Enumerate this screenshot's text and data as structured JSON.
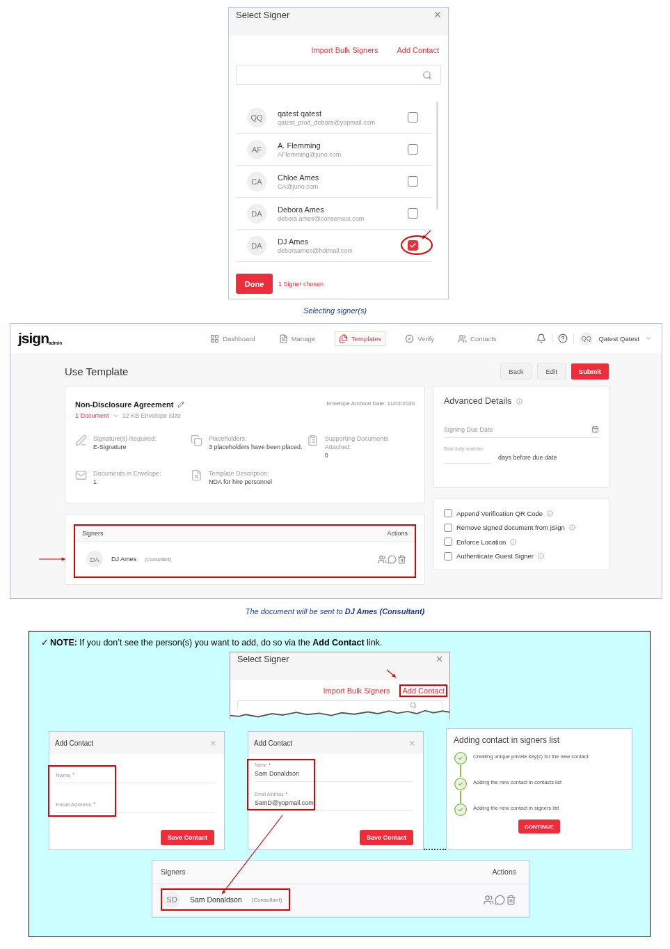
{
  "select_signer": {
    "title": "Select Signer",
    "links": [
      "Import Bulk Signers",
      "Add Contact"
    ],
    "contacts": [
      {
        "initials": "QQ",
        "name": "qatest qatest",
        "email": "qatest_prod_debora@yopmail.com",
        "checked": false,
        "highlighted": false
      },
      {
        "initials": "AF",
        "name": "A. Flemming",
        "email": "AFlemming@juno.com",
        "checked": false,
        "highlighted": false
      },
      {
        "initials": "CA",
        "name": "Chloe Ames",
        "email": "CA@juno.com",
        "checked": false,
        "highlighted": false
      },
      {
        "initials": "DA",
        "name": "Debora Ames",
        "email": "debora.ames@consensus.com",
        "checked": false,
        "highlighted": false
      },
      {
        "initials": "DA",
        "name": "DJ Ames",
        "email": "deboraames@hotmail.com",
        "checked": true,
        "highlighted": true
      }
    ],
    "done_button": "Done",
    "chosen_count": "1 Signer chosen"
  },
  "caption_1": "Selecting signer(s)",
  "app": {
    "logo": "jsign",
    "logo_suffix": "admin",
    "nav": [
      {
        "label": "Dashboard",
        "selected": false
      },
      {
        "label": "Manage",
        "selected": false
      },
      {
        "label": "Templates",
        "selected": true
      },
      {
        "label": "Verify",
        "selected": false
      },
      {
        "label": "Contacts",
        "selected": false
      }
    ],
    "user": {
      "initials": "QQ",
      "name": "Qatest Qatest"
    },
    "page_title": "Use Template",
    "buttons": [
      {
        "label": "Back",
        "kind": "plain"
      },
      {
        "label": "Edit",
        "kind": "plain"
      },
      {
        "label": "Submit",
        "kind": "primary"
      }
    ],
    "template": {
      "name": "Non-Disclosure Agreement",
      "archival_date": "Envelope Archival Date: 11/02/2030",
      "documents_link": "1 Document",
      "envelope_size": "12 KB Envelope Size",
      "details": [
        {
          "label": "Signature(s) Required:",
          "value": "E-Signature"
        },
        {
          "label": "Placeholders:",
          "value": "3 placeholders have been placed."
        },
        {
          "label": "Supporting Documents Attached:",
          "value": "0"
        },
        {
          "label": "Documents in Envelope:",
          "value": "1"
        },
        {
          "label": "Template Description:",
          "value": "NDA for hire personnel"
        }
      ]
    },
    "signers": {
      "header": "Signers",
      "actions_header": "Actions",
      "highlighted": true,
      "rows": [
        {
          "initials": "DA",
          "name": "DJ Ames",
          "role": "(Consultant)",
          "pointed": true
        }
      ]
    },
    "advanced": {
      "title": "Advanced Details",
      "due_date": {
        "placeholder": "Signing Due Date"
      },
      "reminder_label": "Start daily reminder",
      "reminder_suffix": "days before due date"
    },
    "options": [
      {
        "label": "Append Verification QR Code",
        "checked": false
      },
      {
        "label": "Remove signed document from jSign",
        "checked": false
      },
      {
        "label": "Enforce Location",
        "checked": false
      },
      {
        "label": "Authenticate Guest Signer",
        "checked": false
      }
    ]
  },
  "caption_2": "The document will be sent to **DJ Ames (Consultant)**",
  "note": {
    "tick": "✓",
    "text": "**NOTE:** If you don’t see the person(s) you want to add, do so via the **Add Contact** link.",
    "mini_dialog": {
      "title": "Select Signer",
      "links": [
        {
          "label": "Import Bulk Signers",
          "highlighted": false
        },
        {
          "label": "Add Contact",
          "highlighted": true
        }
      ]
    },
    "add_contact_dialogs": [
      {
        "title": "Add Contact",
        "highlighted": true,
        "fields": [
          {
            "label": "Name",
            "mark": "*"
          },
          {
            "label": "Email Address",
            "mark": "*"
          }
        ],
        "button": "Save Contact"
      },
      {
        "title": "Add Contact",
        "highlighted": true,
        "fields": [
          {
            "label": "Name",
            "mark": "*",
            "value": "Sam Donaldson"
          },
          {
            "label": "Email Address",
            "mark": "*",
            "value": "SamD@yopmail.com"
          }
        ],
        "button": "Save Contact"
      }
    ],
    "progress": {
      "title": "Adding contact in signers list",
      "steps": [
        {
          "label": "Creating unique private key(s) for the new contact",
          "done": true
        },
        {
          "label": "Adding the new contact in contacts list",
          "done": true
        },
        {
          "label": "Adding the new contact in signers list",
          "done": true
        }
      ],
      "button": "CONTINUE"
    },
    "signers": {
      "header": "Signers",
      "actions_header": "Actions",
      "rows": [
        {
          "initials": "SD",
          "name": "Sam Donaldson",
          "role": "(Consultant)",
          "highlighted": true
        }
      ]
    }
  }
}
